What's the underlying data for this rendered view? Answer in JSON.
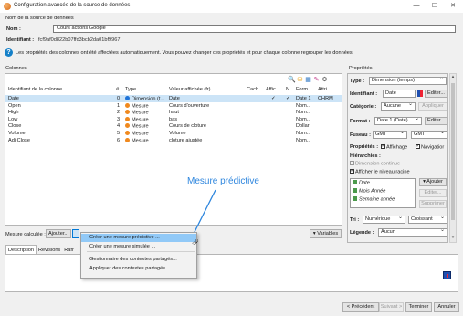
{
  "window": {
    "title": "Configuration avancée de la source de données",
    "minimize_icon": "—",
    "maximize_icon": "☐",
    "close_icon": "✕"
  },
  "datasource": {
    "section_label": "Nom de la source de données",
    "name_label": "Nom :",
    "name_value": "Cours actions Google",
    "identifier_label": "Identifiant :",
    "identifier_value": "fcf9af0d822b07ffd3bcb2da01bf9967"
  },
  "info": {
    "text": "Les propriétés des colonnes ont été affectées automatiquement. Vous pouvez changer ces propriétés et pour chaque colonne regrouper les données."
  },
  "columns": {
    "label": "Colonnes",
    "toolbar_icons": [
      "search-icon",
      "hierarchy-icon",
      "table-icon",
      "edit-icon",
      "settings-icon"
    ],
    "toolbar_glyphs": [
      "🔍",
      "⛁",
      "▦",
      "✎",
      "⚙"
    ],
    "headers": [
      "Identifiant de la colonne",
      "#",
      "Type",
      "Valeur affichée (fr)",
      "Cach...",
      "Affic...",
      "N",
      "Form...",
      "Attri..."
    ],
    "rows": [
      {
        "id": "Date",
        "num": "0",
        "type": "Dimension (t...",
        "type_color": "#1e73d8",
        "label": "Date",
        "hidden": "",
        "display": "✓",
        "n": "✓",
        "format": "Date 1",
        "attr": "CHRM"
      },
      {
        "id": "Open",
        "num": "1",
        "type": "Mesure",
        "type_color": "#f0891e",
        "label": "Cours d'ouverture",
        "hidden": "",
        "display": "",
        "n": "",
        "format": "Nom...",
        "attr": ""
      },
      {
        "id": "High",
        "num": "2",
        "type": "Mesure",
        "type_color": "#f0891e",
        "label": "haut",
        "hidden": "",
        "display": "",
        "n": "",
        "format": "Nom...",
        "attr": ""
      },
      {
        "id": "Low",
        "num": "3",
        "type": "Mesure",
        "type_color": "#f0891e",
        "label": "bas",
        "hidden": "",
        "display": "",
        "n": "",
        "format": "Nom...",
        "attr": ""
      },
      {
        "id": "Close",
        "num": "4",
        "type": "Mesure",
        "type_color": "#f0891e",
        "label": "Cours de cloture",
        "hidden": "",
        "display": "",
        "n": "",
        "format": "Dollar",
        "attr": ""
      },
      {
        "id": "Volume",
        "num": "5",
        "type": "Mesure",
        "type_color": "#f0891e",
        "label": "Volume",
        "hidden": "",
        "display": "",
        "n": "",
        "format": "Nom...",
        "attr": ""
      },
      {
        "id": "Adj Close",
        "num": "6",
        "type": "Mesure",
        "type_color": "#f0891e",
        "label": "cloture ajustée",
        "hidden": "",
        "display": "",
        "n": "",
        "format": "Nom...",
        "attr": ""
      }
    ],
    "calc_measure_label": "Mesure calculée :",
    "add_button": "Ajouter...",
    "variables_button": "Variables",
    "variables_icon": "▾"
  },
  "context_menu": {
    "items": [
      "Créer une mesure prédictive ...",
      "Créer une mesure simulée ...",
      "Gestionnaire des contextes partagés...",
      "Appliquer des contextes partagés..."
    ]
  },
  "annotation": {
    "text": "Mesure prédictive",
    "color": "#2e86de"
  },
  "tabs": {
    "items": [
      "Description",
      "Revisions",
      "Rafr"
    ]
  },
  "properties": {
    "label": "Propriétés",
    "type_label": "Type :",
    "type_value": "Dimension (temps)",
    "identifier_label": "Identifiant :",
    "identifier_value": "Date",
    "edit_button": "Editer...",
    "category_label": "Catégorie :",
    "category_value": "Aucune",
    "apply_button": "Appliquer",
    "format_label": "Format :",
    "format_value": "Date 1 (Date)",
    "format_edit_button": "Editer...",
    "timezone_label": "Fuseau :",
    "timezone_value1": "GMT",
    "timezone_value2": "GMT",
    "props_label": "Propriétés :",
    "display_checkbox": "Affichage",
    "navigation_checkbox": "Navigatior",
    "hierarchies_label": "Hiérarchies :",
    "continuous_dimension": "Dimension continue",
    "show_root_level": "Afficher le niveau racine",
    "hierarchy_items": [
      "Date",
      "Mois Année",
      "Semaine année"
    ],
    "add_button": "Ajouter",
    "edit_button2": "Editer...",
    "delete_button": "Supprimer",
    "sort_label": "Tri :",
    "sort_value": "Numérique",
    "order_value": "Croissant",
    "legend_label": "Légende :",
    "legend_value": "Aucun"
  },
  "footer": {
    "prev": "< Précédent",
    "next": "Suivant >",
    "finish": "Terminer",
    "cancel": "Annuler"
  }
}
